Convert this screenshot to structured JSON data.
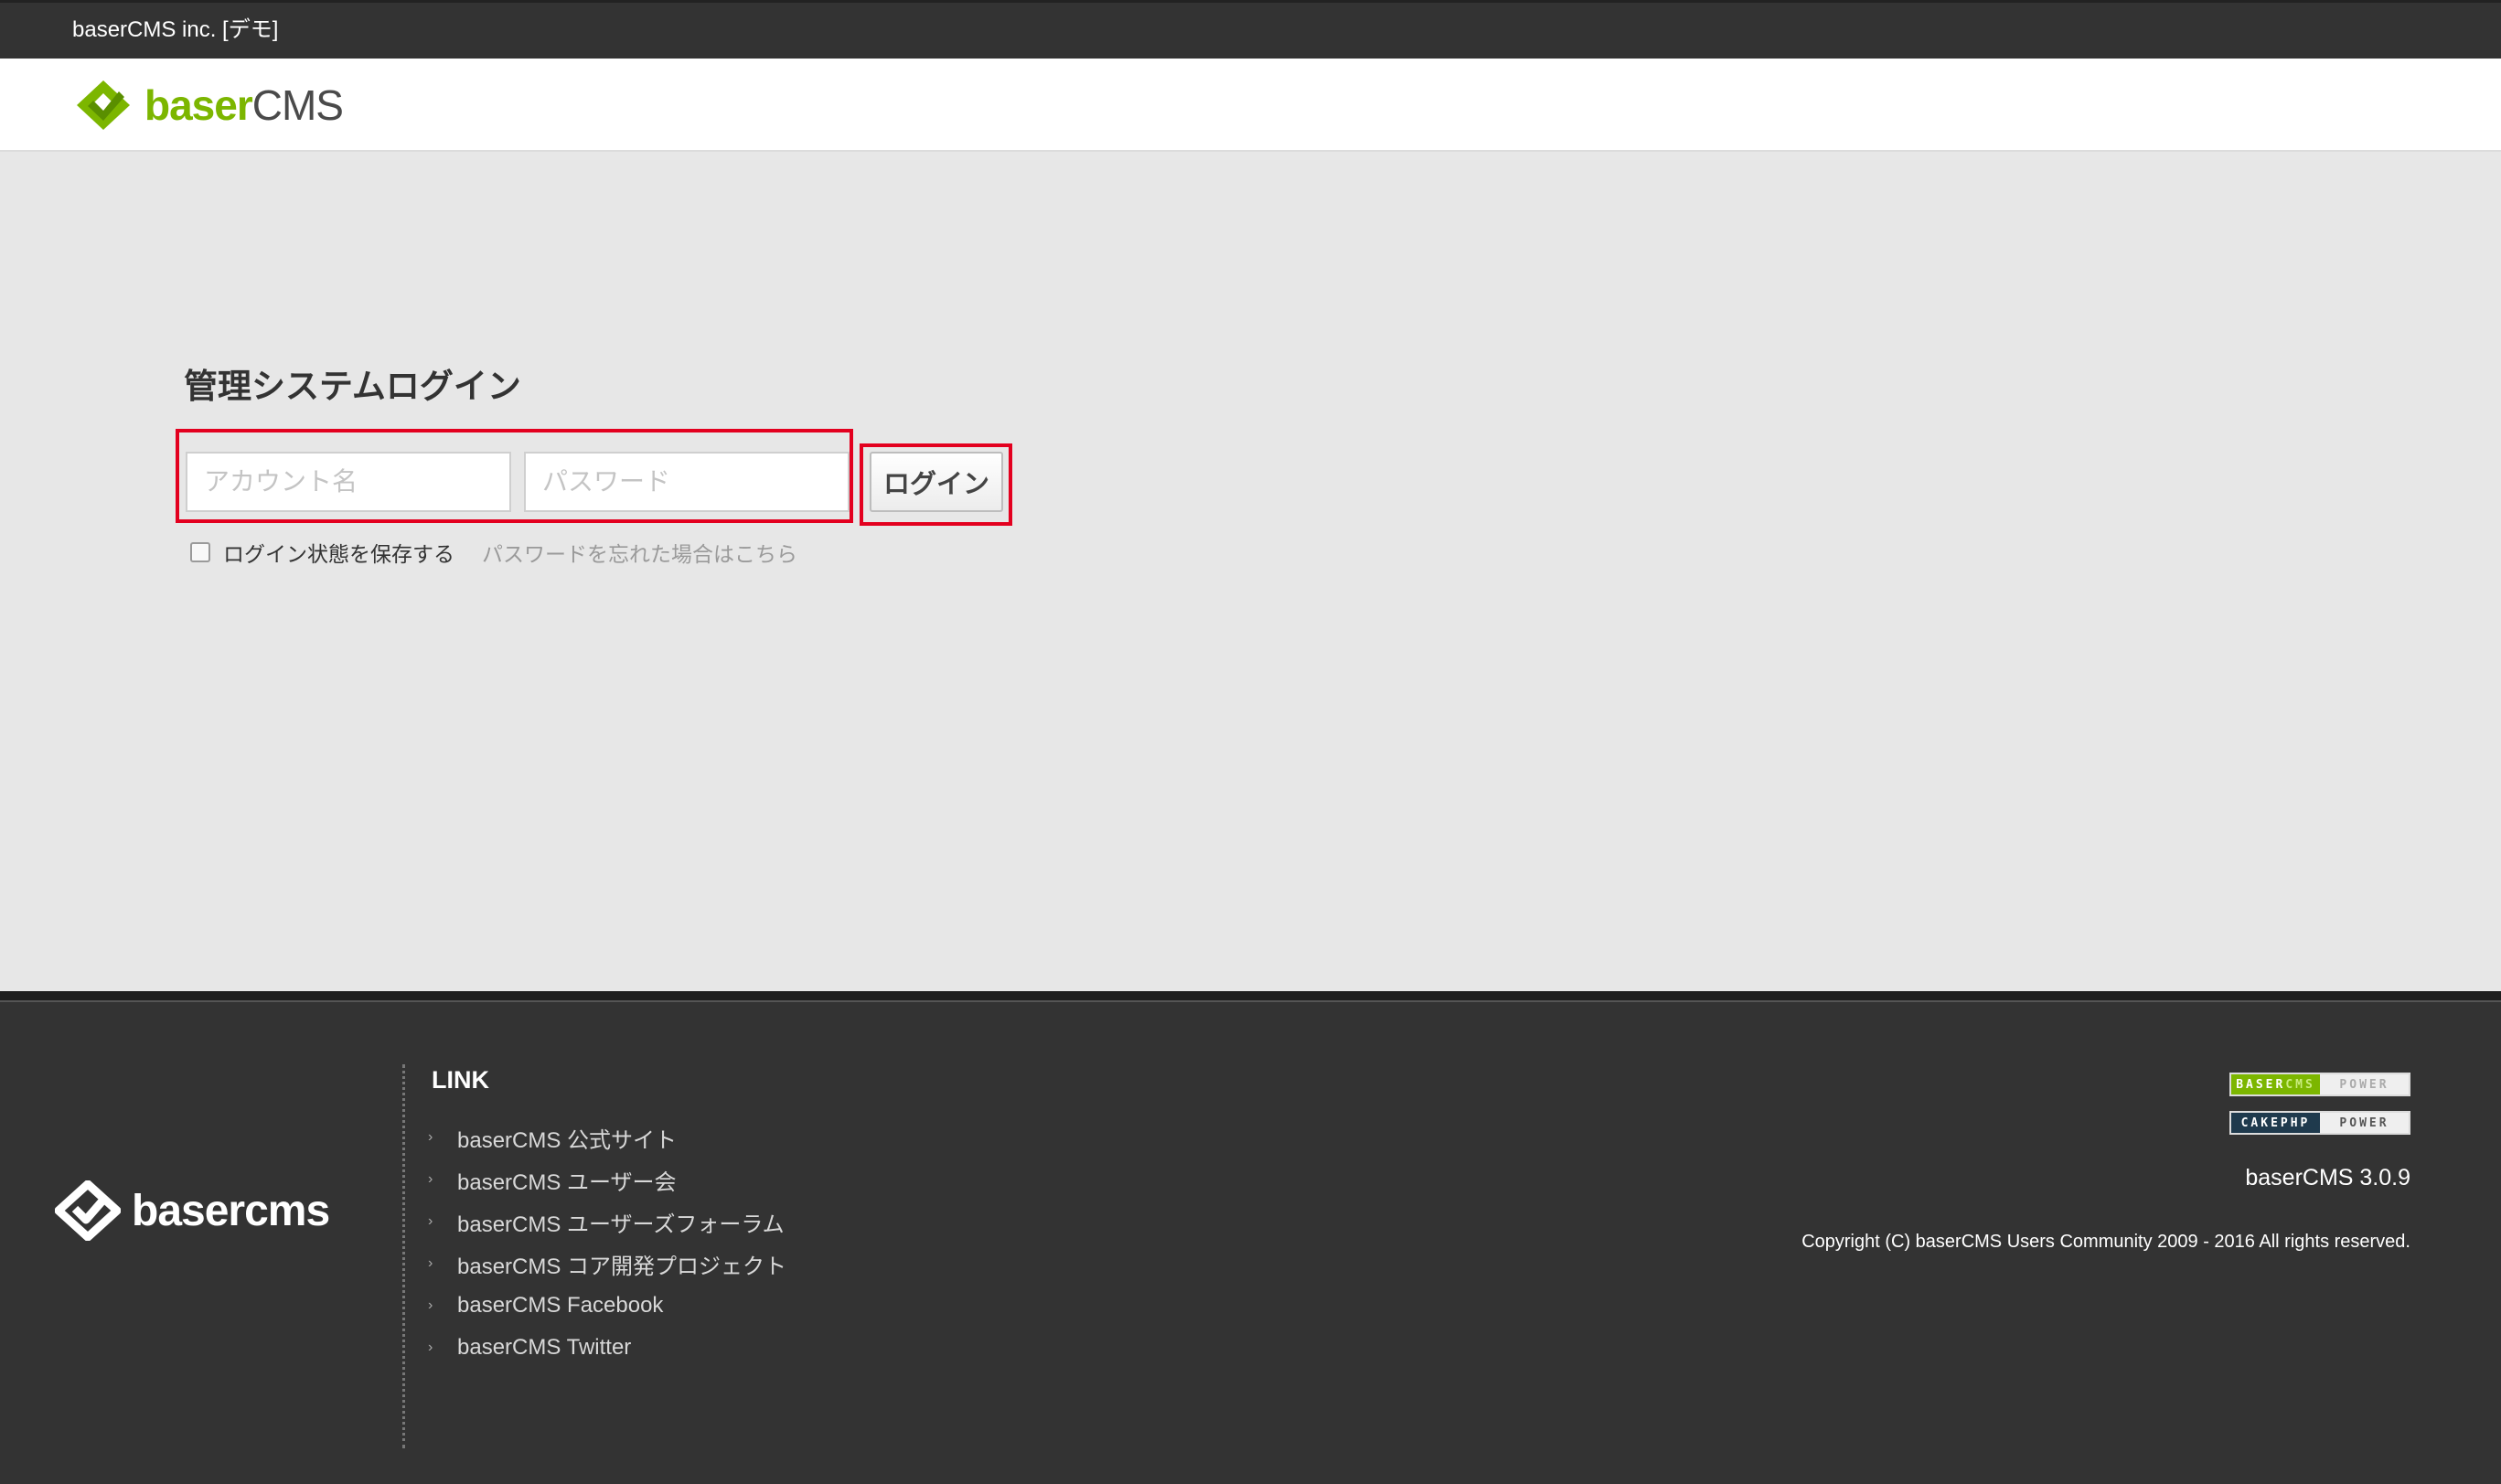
{
  "topbar": {
    "site_name": "baserCMS inc. [デモ]"
  },
  "header": {
    "logo_text_main": "baser",
    "logo_text_sub": "CMS",
    "brand_color": "#7cb600"
  },
  "login": {
    "title": "管理システムログイン",
    "account_placeholder": "アカウント名",
    "account_value": "",
    "password_placeholder": "パスワード",
    "password_value": "",
    "submit_label": "ログイン",
    "remember_label": "ログイン状態を保存する",
    "remember_checked": false,
    "forgot_link": "パスワードを忘れた場合はこちら",
    "highlight_color": "#e3001f"
  },
  "footer": {
    "logo_text": "basercms",
    "links_heading": "LINK",
    "links": [
      {
        "label": "baserCMS 公式サイト"
      },
      {
        "label": "baserCMS ユーザー会"
      },
      {
        "label": "baserCMS ユーザーズフォーラム"
      },
      {
        "label": "baserCMS コア開発プロジェクト"
      },
      {
        "label": "baserCMS Facebook"
      },
      {
        "label": "baserCMS Twitter"
      }
    ],
    "badges": {
      "baser_left": "BASER",
      "baser_left_sub": "CMS",
      "baser_right": "POWER",
      "cake_left": "CAKEPHP",
      "cake_right": "POWER"
    },
    "version": "baserCMS 3.0.9",
    "copyright": "Copyright (C) baserCMS Users Community 2009 - 2016 All rights reserved."
  }
}
